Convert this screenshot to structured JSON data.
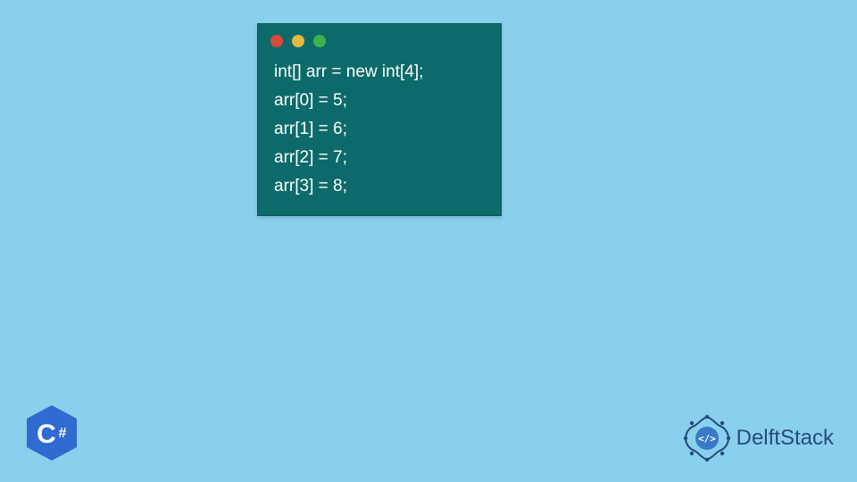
{
  "colors": {
    "background": "#89d0ec",
    "code_window_bg": "#0c6a6a",
    "code_text": "#ffffff",
    "light_red": "#d94a3a",
    "light_yellow": "#e2b940",
    "light_green": "#3db14a",
    "badge_blue": "#2f6bd0",
    "delft_blue": "#264b7a"
  },
  "traffic_lights": [
    "red",
    "yellow",
    "green"
  ],
  "code": {
    "lines": [
      "int[] arr = new int[4];",
      "arr[0] = 5;",
      "arr[1] = 6;",
      "arr[2] = 7;",
      "arr[3] = 8;"
    ]
  },
  "badge": {
    "language": "C#",
    "text_upper": "C",
    "text_hash": "#"
  },
  "brand": {
    "name": "DelftStack",
    "icon_inner": "</>"
  }
}
